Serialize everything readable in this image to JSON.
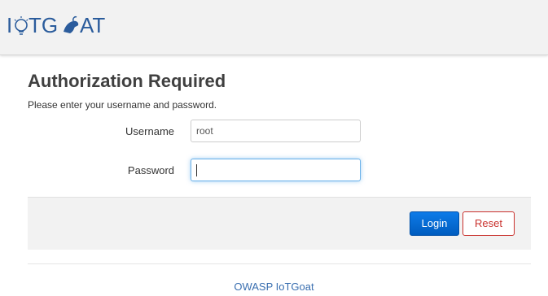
{
  "header": {
    "logo_alt": "IoTGoat",
    "logo_icon": "lightbulb-goat-icon",
    "logo_color": "#2b5c9c"
  },
  "page": {
    "title": "Authorization Required",
    "subtitle": "Please enter your username and password."
  },
  "form": {
    "username_label": "Username",
    "username_value": "root",
    "password_label": "Password",
    "password_value": ""
  },
  "actions": {
    "login_label": "Login",
    "reset_label": "Reset",
    "login_color": "#0069d6",
    "reset_color": "#c9302c"
  },
  "footer": {
    "link_text": "OWASP IoTGoat"
  }
}
